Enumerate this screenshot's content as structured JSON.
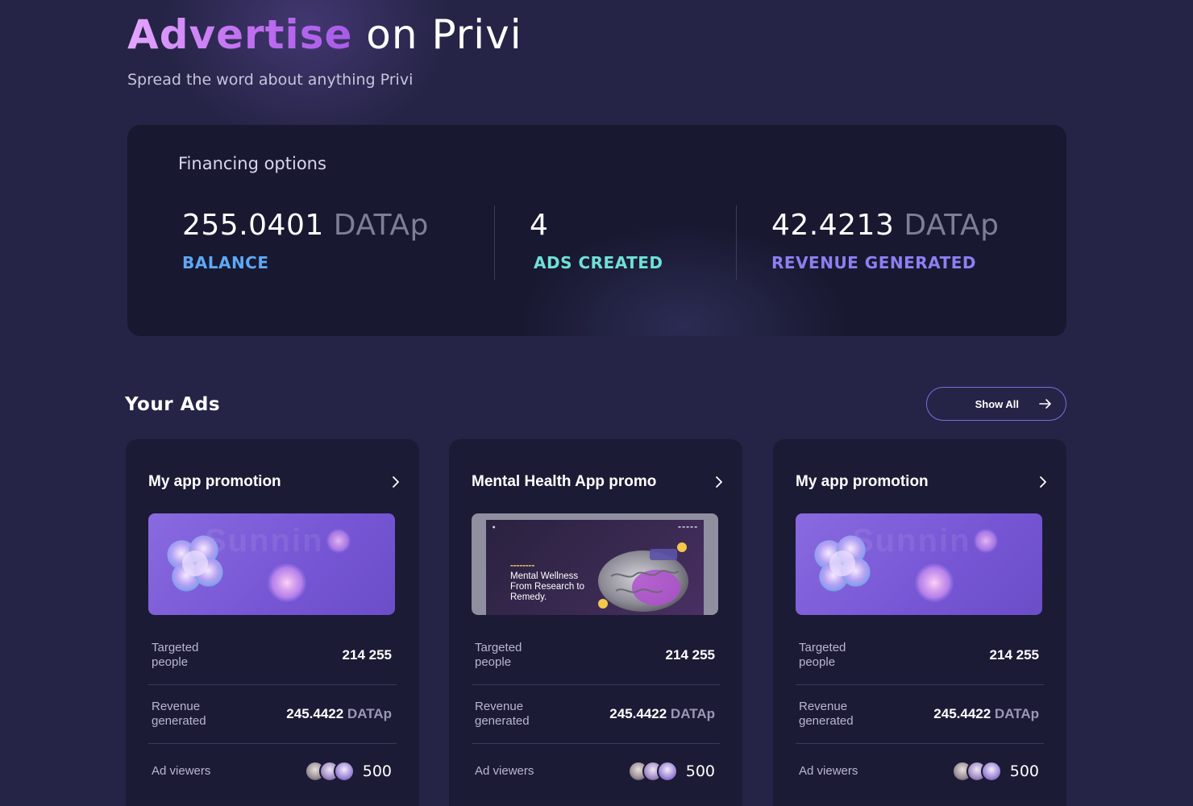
{
  "header": {
    "title_accent": "Advertise",
    "title_rest": " on Privi",
    "subtitle": "Spread the word about anything Privi"
  },
  "financing": {
    "title": "Financing options",
    "stats": [
      {
        "value": "255.0401",
        "unit": "DATAp",
        "label": "BALANCE",
        "label_color": "#5ea8f4"
      },
      {
        "value": "4",
        "unit": "",
        "label": "ADS CREATED",
        "label_color": "#6fe0d6"
      },
      {
        "value": "42.4213",
        "unit": "DATAp",
        "label": "REVENUE GENERATED",
        "label_color": "#8e7ff2"
      }
    ]
  },
  "ads_section": {
    "title": "Your Ads",
    "show_all_label": "Show All"
  },
  "ads": [
    {
      "title": "My app promotion",
      "image_type": "promo",
      "image_text": "Sunnin",
      "targeted_label": "Targeted people",
      "targeted_value": "214 255",
      "revenue_label": "Revenue generated",
      "revenue_value": "245.4422",
      "revenue_unit": "DATAp",
      "viewers_label": "Ad viewers",
      "viewers_count": "500"
    },
    {
      "title": "Mental Health App promo",
      "image_type": "mental",
      "image_headline": "Mental Wellness From Research to Remedy.",
      "targeted_label": "Targeted people",
      "targeted_value": "214 255",
      "revenue_label": "Revenue generated",
      "revenue_value": "245.4422",
      "revenue_unit": "DATAp",
      "viewers_label": "Ad viewers",
      "viewers_count": "500"
    },
    {
      "title": "My app promotion",
      "image_type": "promo",
      "image_text": "Sunnin",
      "targeted_label": "Targeted people",
      "targeted_value": "214 255",
      "revenue_label": "Revenue generated",
      "revenue_value": "245.4422",
      "revenue_unit": "DATAp",
      "viewers_label": "Ad viewers",
      "viewers_count": "500"
    }
  ],
  "colors": {
    "background": "#252446",
    "card": "#1c1b35",
    "accent_purple": "#c071f0",
    "button_border": "#7a6ee0"
  },
  "icons": {
    "show_all": "arrow-right-icon",
    "card_link": "chevron-right-icon",
    "ad_image_shape": "glass-clover-icon"
  }
}
